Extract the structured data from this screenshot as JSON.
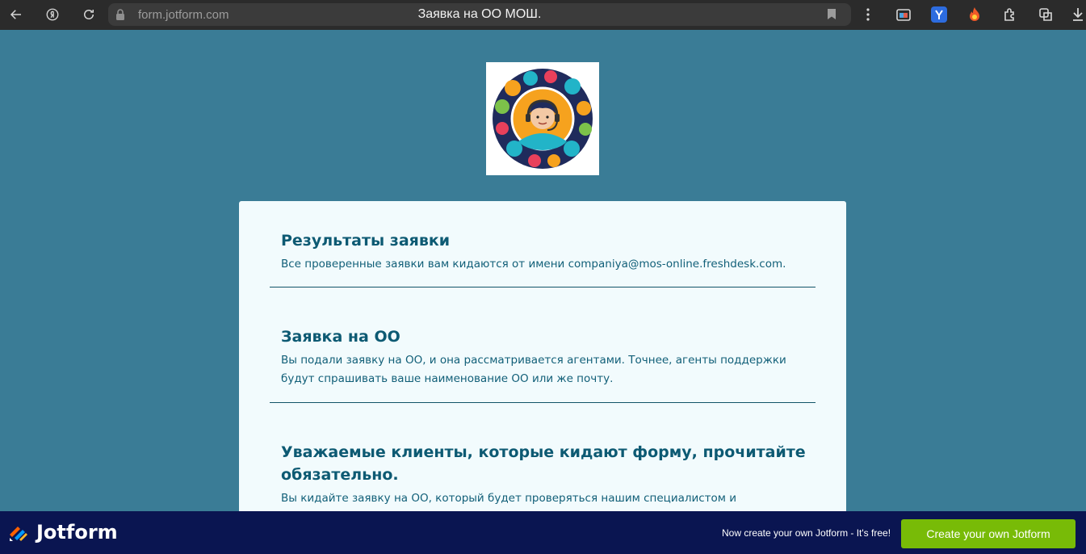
{
  "browser": {
    "url": "form.jotform.com",
    "title": "Заявка на ОО МОШ."
  },
  "sections": [
    {
      "heading": "Результаты заявки",
      "text": "Все проверенные заявки вам кидаются от имени companiya@mos-online.freshdesk.com."
    },
    {
      "heading": "Заявка на ОО",
      "text": "Вы подали заявку на ОО, и она рассматривается агентами. Точнее, агенты поддержки будут спрашивать ваше наименование ОО или же почту."
    },
    {
      "heading": "Уважаемые клиенты, которые кидают форму, прочитайте обязательно.",
      "text": "Вы кидайте заявку на ОО, который будет проверяться нашим специалистом и"
    }
  ],
  "footer": {
    "brand": "Jotform",
    "tagline": "Now create your own Jotform - It's free!",
    "cta": "Create your own Jotform"
  },
  "colors": {
    "page_bg": "#3a7c96",
    "card_bg": "#f2fbfd",
    "heading": "#0d5a73",
    "footer_bg": "#0a1551",
    "cta_bg": "#78bb07"
  }
}
